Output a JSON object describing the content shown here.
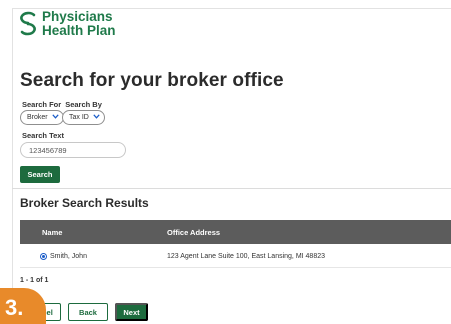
{
  "brand": {
    "line1": "Physicians",
    "line2": "Health Plan",
    "color": "#1f7a4a"
  },
  "page": {
    "title": "Search for your broker office"
  },
  "search_form": {
    "search_for_label": "Search For",
    "search_by_label": "Search By",
    "search_for_value": "Broker",
    "search_by_value": "Tax ID",
    "search_text_label": "Search Text",
    "search_text_value": "123456789",
    "search_button": "Search"
  },
  "results": {
    "title": "Broker Search Results",
    "columns": [
      "Name",
      "Office Address"
    ],
    "rows": [
      {
        "name": "Smith, John",
        "address": "123 Agent Lane Suite 100, East Lansing, MI 48823",
        "selected": true
      }
    ],
    "count": "1 - 1 of 1"
  },
  "footer": {
    "cancel": "Cancel",
    "back": "Back",
    "next": "Next"
  },
  "step_badge": "3.",
  "colors": {
    "primary_green": "#1d6b3e",
    "header_gray": "#5c5c5c",
    "badge_orange": "#e88a2a",
    "link_blue": "#1a5cc8"
  }
}
